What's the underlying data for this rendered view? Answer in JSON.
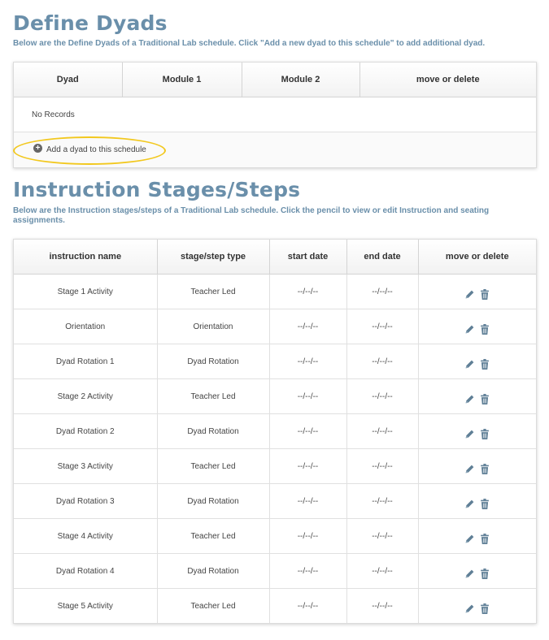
{
  "dyads": {
    "title": "Define Dyads",
    "description": "Below are the Define Dyads of a Traditional Lab schedule. Click \"Add a new dyad to this schedule\" to add additional dyad.",
    "columns": [
      "Dyad",
      "Module 1",
      "Module 2",
      "move or delete"
    ],
    "empty_text": "No Records",
    "add_label": "Add a dyad to this schedule",
    "add_icon": "plus-circle-icon",
    "highlight_color": "#f2c81e"
  },
  "stages": {
    "title": "Instruction Stages/Steps",
    "description": "Below are the Instruction stages/steps of a Traditional Lab schedule. Click the pencil to view or edit Instruction and seating assignments.",
    "columns": [
      "instruction name",
      "stage/step type",
      "start date",
      "end date",
      "move or delete"
    ],
    "rows": [
      {
        "name": "Stage 1 Activity",
        "type": "Teacher Led",
        "start": "--/--/--",
        "end": "--/--/--"
      },
      {
        "name": "Orientation",
        "type": "Orientation",
        "start": "--/--/--",
        "end": "--/--/--"
      },
      {
        "name": "Dyad Rotation 1",
        "type": "Dyad Rotation",
        "start": "--/--/--",
        "end": "--/--/--"
      },
      {
        "name": "Stage 2 Activity",
        "type": "Teacher Led",
        "start": "--/--/--",
        "end": "--/--/--"
      },
      {
        "name": "Dyad Rotation 2",
        "type": "Dyad Rotation",
        "start": "--/--/--",
        "end": "--/--/--"
      },
      {
        "name": "Stage 3 Activity",
        "type": "Teacher Led",
        "start": "--/--/--",
        "end": "--/--/--"
      },
      {
        "name": "Dyad Rotation 3",
        "type": "Dyad Rotation",
        "start": "--/--/--",
        "end": "--/--/--"
      },
      {
        "name": "Stage 4 Activity",
        "type": "Teacher Led",
        "start": "--/--/--",
        "end": "--/--/--"
      },
      {
        "name": "Dyad Rotation 4",
        "type": "Dyad Rotation",
        "start": "--/--/--",
        "end": "--/--/--"
      },
      {
        "name": "Stage 5 Activity",
        "type": "Teacher Led",
        "start": "--/--/--",
        "end": "--/--/--"
      }
    ],
    "row_icons": [
      "pencil-icon",
      "trash-icon"
    ]
  },
  "colors": {
    "heading": "#6a8faa",
    "icon": "#5f7f96"
  }
}
